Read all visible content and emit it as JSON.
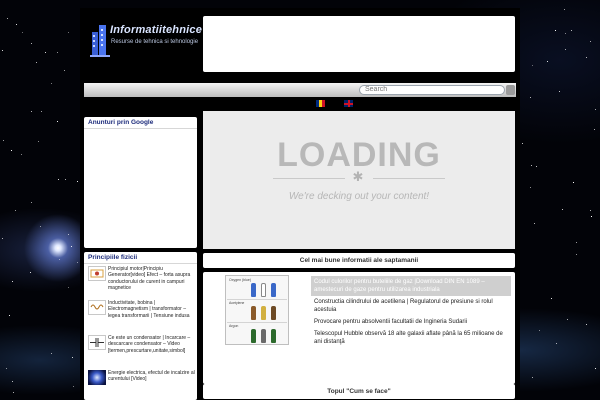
{
  "logo": {
    "title": "Informatiitehnice",
    "subtitle": "Resurse de tehnica si tehnologie"
  },
  "search": {
    "placeholder": "Search"
  },
  "languages": [
    {
      "code": "ro",
      "name": "romanian-flag-icon"
    },
    {
      "code": "en",
      "name": "english-flag-icon"
    }
  ],
  "sidebar": {
    "ads_title": "Anunturi prin Google",
    "physics_title": "Principiile fizicii",
    "posts": [
      {
        "text": "Principiul motor|Principiu Generator[video] Efect – forta asupra conductorului de curent in campuri magnetice",
        "thumb": "motor-diagram"
      },
      {
        "text": "Inductivitate, bobina | Electromagnetism | transformator – legea transformarii | Tensiune indusa",
        "thumb": "coil-diagram"
      },
      {
        "text": "Ce este un condensator | Incarcare – descarcare condensator – Video [termen,prescurtare,unitate,simbol]",
        "thumb": "capacitor-diagram"
      },
      {
        "text": "Energie electrica, efectul de incalzire al curentului [Video]",
        "thumb": "energy-photo"
      }
    ]
  },
  "loading": {
    "title": "LOADING",
    "subtitle": "We're decking out your content!"
  },
  "featured": {
    "header": "Cel mai bune informatii ale saptamanii",
    "image_rows": [
      "Oxygen (blue)",
      "Acetylene",
      "Argon"
    ],
    "items": [
      {
        "text": "Codul culorilor pentru buteliile de gaz |Download DIN EN 1089 – amestecuri de gaze pentru utilizarea industriala",
        "active": true
      },
      {
        "text": "Constructia cilindrului de acetilena | Regulatorul de presiune si rolul acestuia",
        "active": false
      },
      {
        "text": "Provocare pentru absolventii facultatii de Ingineria Sudarii",
        "active": false
      },
      {
        "text": "Telescopul Hubble observă 18 alte galaxii aflate până la 65 milioane de ani distanţă",
        "active": false
      }
    ]
  },
  "howto": {
    "header": "Topul \"Cum se face\""
  },
  "colors": {
    "page_bg": "#000000",
    "panel_bg": "#ffffff",
    "loading_bg": "#ececec",
    "loading_text": "#b8b8b8",
    "sidebar_title": "#1b2a7a",
    "active_item": "#cfcfcf"
  }
}
